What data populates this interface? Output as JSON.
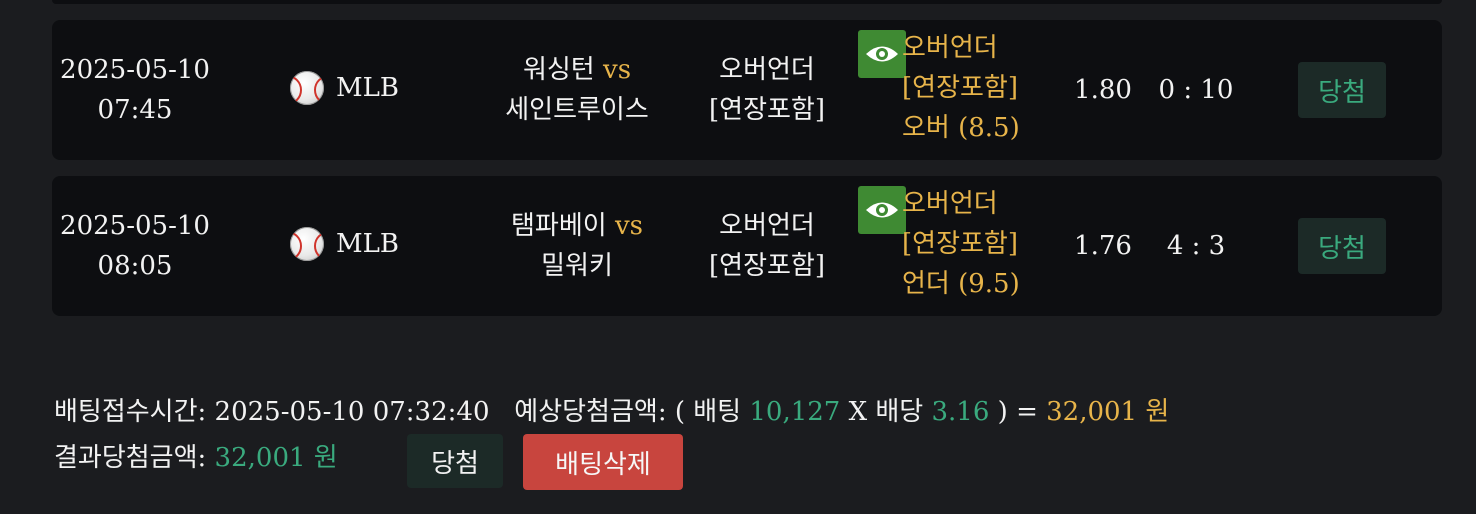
{
  "bets": [
    {
      "date": "2025-05-10",
      "time": "07:45",
      "league": "MLB",
      "home": "워싱턴",
      "vs": "vs",
      "away": "세인트루이스",
      "bet_type_line1": "오버언더",
      "bet_type_line2": "[연장포함]",
      "pick_line1": "오버언더",
      "pick_line2": "[연장포함]",
      "pick_line3": "오버 (8.5)",
      "odds": "1.80",
      "score": "0 : 10",
      "status": "당첨"
    },
    {
      "date": "2025-05-10",
      "time": "08:05",
      "league": "MLB",
      "home": "탬파베이",
      "vs": "vs",
      "away": "밀워키",
      "bet_type_line1": "오버언더",
      "bet_type_line2": "[연장포함]",
      "pick_line1": "오버언더",
      "pick_line2": "[연장포함]",
      "pick_line3": "언더 (9.5)",
      "odds": "1.76",
      "score": "4 : 3",
      "status": "당첨"
    }
  ],
  "summary": {
    "received_label": "배팅접수시간:",
    "received_time": "2025-05-10 07:32:40",
    "expected_label": "예상당첨금액: ( 배팅",
    "stake": "10,127",
    "times": "X 배당",
    "total_odds": "3.16",
    "equals": ") =",
    "expected_amount": "32,001 원",
    "result_label": "결과당첨금액:",
    "result_amount": "32,001 원",
    "win_button": "당첨",
    "delete_button": "배팅삭제"
  },
  "colors": {
    "accent_gold": "#e7b44a",
    "win_green": "#3aaa7e",
    "delete_red": "#c8453e",
    "eye_green": "#3f8a33"
  },
  "icons": {
    "view": "eye-icon",
    "sport": "baseball-icon"
  }
}
